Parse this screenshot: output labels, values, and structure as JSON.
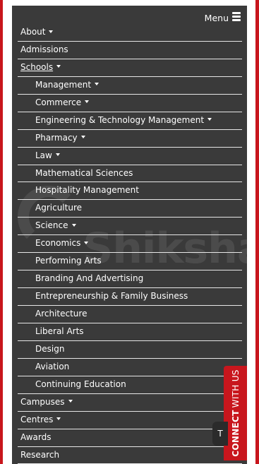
{
  "header": {
    "menu_label": "Menu"
  },
  "watermark_text": "Shiksha",
  "menu": {
    "items": [
      {
        "label": "About",
        "dropdown": true,
        "level": 0
      },
      {
        "label": "Admissions",
        "dropdown": false,
        "level": 0
      },
      {
        "label": "Schools",
        "dropdown": true,
        "level": 0,
        "underlined": true
      },
      {
        "label": "Management",
        "dropdown": true,
        "level": 1
      },
      {
        "label": "Commerce",
        "dropdown": true,
        "level": 1
      },
      {
        "label": "Engineering & Technology Management",
        "dropdown": true,
        "level": 1
      },
      {
        "label": "Pharmacy",
        "dropdown": true,
        "level": 1
      },
      {
        "label": "Law",
        "dropdown": true,
        "level": 1
      },
      {
        "label": "Mathematical Sciences",
        "dropdown": false,
        "level": 1
      },
      {
        "label": "Hospitality Management",
        "dropdown": false,
        "level": 1
      },
      {
        "label": "Agriculture",
        "dropdown": false,
        "level": 1
      },
      {
        "label": "Science",
        "dropdown": true,
        "level": 1
      },
      {
        "label": "Economics",
        "dropdown": true,
        "level": 1
      },
      {
        "label": "Performing Arts",
        "dropdown": false,
        "level": 1
      },
      {
        "label": "Branding And Advertising",
        "dropdown": false,
        "level": 1
      },
      {
        "label": "Entrepreneurship & Family Business",
        "dropdown": false,
        "level": 1
      },
      {
        "label": "Architecture",
        "dropdown": false,
        "level": 1
      },
      {
        "label": "Liberal Arts",
        "dropdown": false,
        "level": 1
      },
      {
        "label": "Design",
        "dropdown": false,
        "level": 1
      },
      {
        "label": "Aviation",
        "dropdown": false,
        "level": 1
      },
      {
        "label": "Continuing Education",
        "dropdown": false,
        "level": 1
      },
      {
        "label": "Campuses",
        "dropdown": true,
        "level": 0
      },
      {
        "label": "Centres",
        "dropdown": true,
        "level": 0
      },
      {
        "label": "Awards",
        "dropdown": false,
        "level": 0
      },
      {
        "label": "Research",
        "dropdown": false,
        "level": 0
      }
    ]
  },
  "connect_tab": {
    "strong": "CONNECT",
    "thin": "WITH US"
  },
  "back_to_top": {
    "label": "T"
  },
  "colors": {
    "accent": "#c8161d",
    "panel": "#3a3a3a",
    "divider": "#e7e7e7",
    "text": "#ffffff"
  }
}
